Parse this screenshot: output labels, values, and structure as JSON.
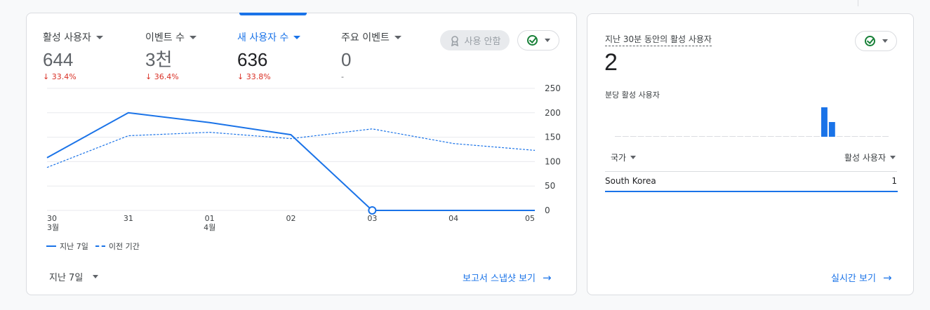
{
  "metrics": [
    {
      "label": "활성 사용자",
      "value": "644",
      "change": "↓ 33.4%"
    },
    {
      "label": "이벤트 수",
      "value": "3천",
      "change": "↓ 36.4%"
    },
    {
      "label": "새 사용자 수",
      "value": "636",
      "change": "↓ 33.8%"
    },
    {
      "label": "주요 이벤트",
      "value": "0",
      "change": "-"
    }
  ],
  "disabled_chip": "사용 안함",
  "legend": {
    "current": "지난 7일",
    "previous": "이전 기간"
  },
  "date_range": "지난 7일",
  "snapshot_link": "보고서 스냅샷 보기",
  "colors": {
    "accent": "#1a73e8",
    "negative": "#d93025",
    "ok": "#188038"
  },
  "chart_data": {
    "type": "line",
    "x": [
      "30",
      "31",
      "01",
      "02",
      "03",
      "04",
      "05"
    ],
    "x_sublabels": [
      "3월",
      "",
      "4월",
      "",
      "",
      "",
      ""
    ],
    "series": [
      {
        "name": "지난 7일",
        "style": "solid",
        "values": [
          108,
          200,
          180,
          155,
          0,
          0,
          0
        ]
      },
      {
        "name": "이전 기간",
        "style": "dashed",
        "values": [
          88,
          153,
          160,
          147,
          167,
          137,
          123
        ]
      }
    ],
    "ylim": [
      0,
      250
    ],
    "yticks": [
      0,
      50,
      100,
      150,
      200,
      250
    ],
    "grid": true,
    "highlight_index": 4,
    "legend_position": "bottom-left"
  },
  "realtime": {
    "title": "지난 30분 동안의 활성 사용자",
    "value": "2",
    "per_minute_label": "분당 활성 사용자",
    "per_minute_values": [
      0,
      0,
      0,
      0,
      0,
      0,
      0,
      0,
      0,
      0,
      0,
      0,
      0,
      0,
      0,
      0,
      0,
      0,
      0,
      0,
      0,
      0,
      0,
      0,
      0,
      0,
      0,
      2,
      1,
      0,
      0,
      0,
      0,
      0,
      0,
      0
    ],
    "col_country": "국가",
    "col_active": "활성 사용자",
    "rows": [
      {
        "country": "South Korea",
        "count": "1"
      }
    ],
    "link": "실시간 보기"
  }
}
